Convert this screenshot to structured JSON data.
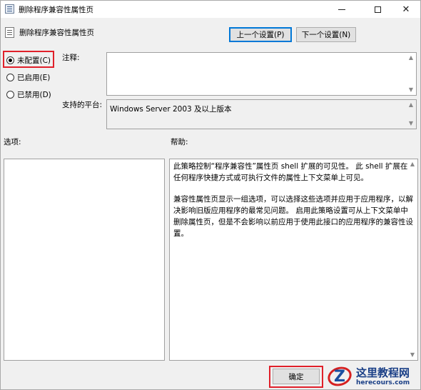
{
  "window": {
    "title": "删除程序兼容性属性页",
    "icon": "policy-icon",
    "controls": {
      "minimize": "—",
      "maximize": "□",
      "close": "✕"
    }
  },
  "header": {
    "title": "删除程序兼容性属性页",
    "prev_button": "上一个设置(P)",
    "next_button": "下一个设置(N)"
  },
  "state": {
    "options": [
      {
        "label": "未配置(C)",
        "checked": true
      },
      {
        "label": "已启用(E)",
        "checked": false
      },
      {
        "label": "已禁用(D)",
        "checked": false
      }
    ]
  },
  "comment": {
    "label": "注释:",
    "value": ""
  },
  "platform": {
    "label": "支持的平台:",
    "value": "Windows Server 2003 及以上版本"
  },
  "options_section": {
    "label": "选项:"
  },
  "help_section": {
    "label": "帮助:",
    "paragraphs": [
      "此策略控制“程序兼容性”属性页 shell 扩展的可见性。 此 shell 扩展在任何程序快捷方式或可执行文件的属性上下文菜单上可见。",
      "兼容性属性页显示一组选项，可以选择这些选项并应用于应用程序，以解决影响旧版应用程序的最常见问题。 启用此策略设置可从上下文菜单中删除属性页，但是不会影响以前应用于使用此接口的应用程序的兼容性设置。"
    ]
  },
  "footer": {
    "ok_button": "确定"
  },
  "watermark": {
    "name": "这里教程网",
    "url": "herecours.com"
  },
  "colors": {
    "highlight": "#e0202a",
    "focus": "#0078d7"
  }
}
